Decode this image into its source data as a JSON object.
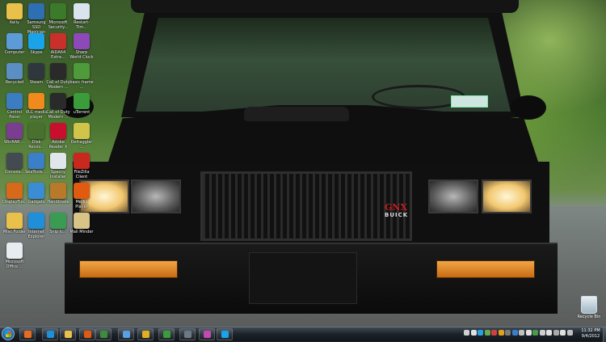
{
  "desktop": {
    "icons": [
      {
        "label": "Kelly",
        "icon": "user-folder-icon",
        "color": "#e9c14a"
      },
      {
        "label": "Samsung SSD Magician",
        "icon": "ssd-magician-icon",
        "color": "#2d6fb2"
      },
      {
        "label": "Microsoft Security...",
        "icon": "security-essentials-icon",
        "color": "#3b7a2a"
      },
      {
        "label": "Restart-Tim...",
        "icon": "restart-timer-icon",
        "color": "#d9e4ec"
      },
      {
        "label": "Computer",
        "icon": "computer-icon",
        "color": "#5c9ad8"
      },
      {
        "label": "Skype",
        "icon": "skype-icon",
        "color": "#1aa3e8"
      },
      {
        "label": "AIDA64 Extre...",
        "icon": "aida64-icon",
        "color": "#c9302c"
      },
      {
        "label": "Sharp World Clock",
        "icon": "world-clock-icon",
        "color": "#8d49b8"
      },
      {
        "label": "Recycled",
        "icon": "recycle-folder-icon",
        "color": "#5b8fc4"
      },
      {
        "label": "Steam",
        "icon": "steam-icon",
        "color": "#30363d"
      },
      {
        "label": "Call of Duty Modern ...",
        "icon": "cod-icon",
        "color": "#2a2a2a"
      },
      {
        "label": "basic frame ...",
        "icon": "frame-icon",
        "color": "#4f9b3b"
      },
      {
        "label": "Control Panel",
        "icon": "control-panel-icon",
        "color": "#3c7cc0"
      },
      {
        "label": "VLC media player",
        "icon": "vlc-icon",
        "color": "#f08a1c"
      },
      {
        "label": "Call of Duty Modern ...",
        "icon": "cod-icon",
        "color": "#2a2a2a"
      },
      {
        "label": "uTorrent",
        "icon": "utorrent-icon",
        "color": "#3a9c3a"
      },
      {
        "label": "WinRAR ...",
        "icon": "winrar-icon",
        "color": "#7a3d8f"
      },
      {
        "label": "Disk Recov...",
        "icon": "disk-recovery-icon",
        "color": "#4a7030"
      },
      {
        "label": "Adobe Reader X",
        "icon": "adobe-reader-icon",
        "color": "#c8102e"
      },
      {
        "label": "Defraggler ...",
        "icon": "defraggler-icon",
        "color": "#d0c44a"
      },
      {
        "label": "Console...",
        "icon": "console-icon",
        "color": "#444a52"
      },
      {
        "label": "SeaTools ...",
        "icon": "seatools-icon",
        "color": "#3a7fc8"
      },
      {
        "label": "Speccy Installer",
        "icon": "speccy-icon",
        "color": "#e0e6ec"
      },
      {
        "label": "FileZilla Client",
        "icon": "filezilla-icon",
        "color": "#c8281e"
      },
      {
        "label": "DisplayFus...",
        "icon": "displayfusion-icon",
        "color": "#d66a1a"
      },
      {
        "label": "Gadgets",
        "icon": "gadgets-icon",
        "color": "#3a8dd4"
      },
      {
        "label": "Handbrake",
        "icon": "handbrake-icon",
        "color": "#b87a2a"
      },
      {
        "label": "Media Player",
        "icon": "media-player-icon",
        "color": "#e05a12"
      },
      {
        "label": "Misc Folder",
        "icon": "folder-icon",
        "color": "#e9c14a"
      },
      {
        "label": "Internet Explorer",
        "icon": "internet-explorer-icon",
        "color": "#1e8fd8"
      },
      {
        "label": "Snip Ic...",
        "icon": "snip-icon",
        "color": "#3a9c52"
      },
      {
        "label": "Mail Minder",
        "icon": "mail-icon",
        "color": "#d9c488"
      },
      {
        "label": "Microsoft Office ...",
        "icon": "office-icon",
        "color": "#e7ecf0"
      }
    ],
    "recycle_bin": {
      "label": "Recycle Bin",
      "icon": "recycle-bin-icon"
    }
  },
  "wallpaper": {
    "badge_gnx": "GNX",
    "badge_buick": "BUICK"
  },
  "taskbar": {
    "pinned": [
      {
        "name": "firefox",
        "icon": "firefox-icon",
        "color": "#e66a1f"
      },
      {
        "name": "internet-explorer",
        "icon": "internet-explorer-icon",
        "color": "#1e8fd8"
      },
      {
        "name": "explorer",
        "icon": "folder-icon",
        "color": "#e9c14a"
      },
      {
        "name": "media-player",
        "icon": "media-player-icon",
        "color": "#e05a12"
      },
      {
        "name": "windows-media-center",
        "icon": "media-center-icon",
        "color": "#3a8d3a"
      },
      {
        "name": "task-manager",
        "icon": "task-manager-icon",
        "color": "#5aa0e0"
      },
      {
        "name": "sticky-notes",
        "icon": "sticky-notes-icon",
        "color": "#e0b020"
      },
      {
        "name": "utorrent",
        "icon": "utorrent-icon",
        "color": "#3a9c3a"
      },
      {
        "name": "steam",
        "icon": "steam-icon",
        "color": "#6d7986"
      },
      {
        "name": "paint",
        "icon": "paint-icon",
        "color": "#c04ab0"
      },
      {
        "name": "skype",
        "icon": "skype-icon",
        "color": "#1aa3e8"
      }
    ],
    "tray_colors": [
      "#d0d0d0",
      "#e0e0e0",
      "#2aa0e0",
      "#6aa84f",
      "#d04040",
      "#e0a020",
      "#7a7a7a",
      "#3a7fc8",
      "#c0c0c0",
      "#e0e0e0",
      "#4a9c4a",
      "#d0d0d0",
      "#e0e0e0",
      "#aaaaaa",
      "#e0e0e0",
      "#c0c0c0"
    ],
    "clock": {
      "time": "11:32 PM",
      "date": "9/4/2012"
    }
  }
}
